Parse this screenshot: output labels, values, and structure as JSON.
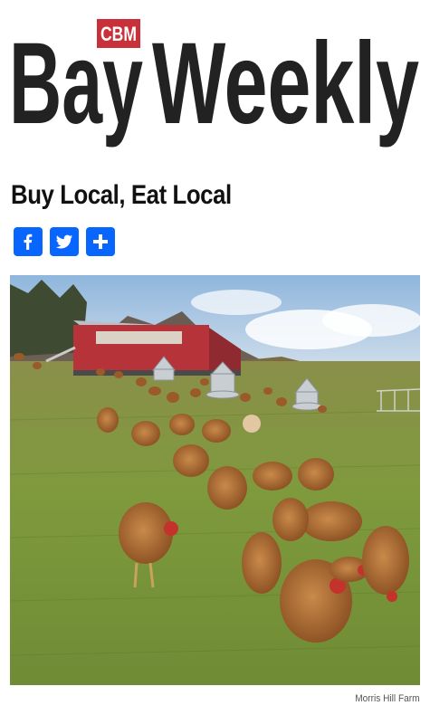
{
  "masthead": {
    "badge": "CBM",
    "title_part1": "Bay",
    "title_part2": "Weekly"
  },
  "article": {
    "headline": "Buy Local, Eat Local",
    "photo_caption": "Morris Hill Farm"
  },
  "share": {
    "buttons": [
      {
        "name": "facebook",
        "icon": "facebook-icon",
        "color": "#0866ff"
      },
      {
        "name": "twitter",
        "icon": "twitter-icon",
        "color": "#0866ff"
      },
      {
        "name": "more",
        "icon": "plus-icon",
        "color": "#0866ff"
      }
    ]
  },
  "colors": {
    "badge_red": "#c8303a",
    "logo_text": "#222222",
    "share_blue": "#0866ff"
  }
}
